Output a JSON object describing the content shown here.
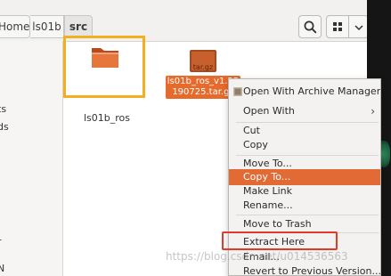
{
  "breadcrumb": {
    "items": [
      "Home",
      "ls01b",
      "src"
    ]
  },
  "sidebar": {
    "items": [
      {
        "label": "ts"
      },
      {
        "label": "ds"
      },
      {
        "label": "r"
      },
      {
        "label": "N"
      }
    ]
  },
  "files": [
    {
      "name": "ls01b_ros",
      "type": "folder-icon"
    },
    {
      "name_line1": "ls01b_ros_v1.22",
      "name_line2": "190725.tar.gz",
      "badge": "tar.gz",
      "type": "archive-icon"
    }
  ],
  "context_menu": {
    "items": [
      {
        "label": "Open With Archive Manager"
      },
      {
        "label": "Open With",
        "submenu": true
      },
      {
        "label": "Cut"
      },
      {
        "label": "Copy"
      },
      {
        "label": "Move To..."
      },
      {
        "label": "Copy To...",
        "active": true
      },
      {
        "label": "Make Link"
      },
      {
        "label": "Rename..."
      },
      {
        "label": "Move to Trash"
      },
      {
        "label": "Extract Here"
      },
      {
        "label": "Email..."
      },
      {
        "label": "Revert to Previous Version..."
      }
    ]
  },
  "watermark": "https://blog.csdn.net/u014536563",
  "colors": {
    "accent": "#e26a35",
    "yellow_box": "#f2b01e",
    "red_box": "#e23a2a"
  }
}
